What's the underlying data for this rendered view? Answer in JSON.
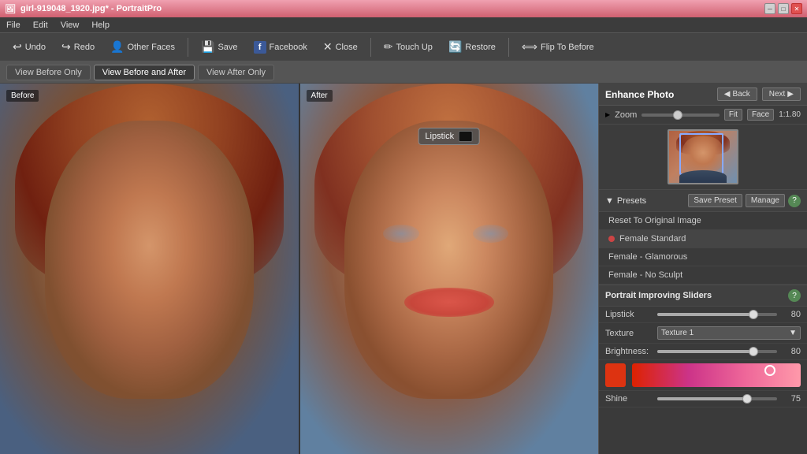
{
  "titleBar": {
    "title": "girl-919048_1920.jpg* - PortraitPro",
    "controls": {
      "min": "–",
      "max": "□",
      "close": "✕"
    }
  },
  "menuBar": {
    "items": [
      "File",
      "Edit",
      "View",
      "Help"
    ]
  },
  "toolbar": {
    "undo": "Undo",
    "redo": "Redo",
    "otherFaces": "Other Faces",
    "save": "Save",
    "facebook": "Facebook",
    "close": "Close",
    "touchUp": "Touch Up",
    "restore": "Restore",
    "flipToBefore": "Flip To Before"
  },
  "viewTabs": {
    "before": "View Before Only",
    "beforeAndAfter": "View Before and After",
    "after": "View After Only"
  },
  "imageLabels": {
    "before": "Before",
    "after": "After"
  },
  "lipstickTooltip": {
    "label": "Lipstick"
  },
  "rightPanel": {
    "enhanceTitle": "Enhance Photo",
    "backBtn": "◀ Back",
    "nextBtn": "Next ▶",
    "zoomLabel": "Zoom",
    "fitBtn": "Fit",
    "faceBtn": "Face",
    "zoomRatio": "1:1.80",
    "presetsHeader": "Presets",
    "savePreset": "Save Preset",
    "manageBtn": "Manage",
    "presetItems": [
      {
        "label": "Reset To Original Image",
        "hasDot": false
      },
      {
        "label": "Female Standard",
        "hasDot": true
      },
      {
        "label": "Female - Glamorous",
        "hasDot": false
      },
      {
        "label": "Female - No Sculpt",
        "hasDot": false
      }
    ],
    "slidersTitle": "Portrait Improving Sliders",
    "sliders": [
      {
        "label": "Lipstick",
        "value": 80,
        "percent": 80
      },
      {
        "label": "Brightness:",
        "value": 80,
        "percent": 80
      },
      {
        "label": "Shine",
        "value": 75,
        "percent": 75
      }
    ],
    "textureLabel": "Texture",
    "textureValue": "Texture 1"
  }
}
